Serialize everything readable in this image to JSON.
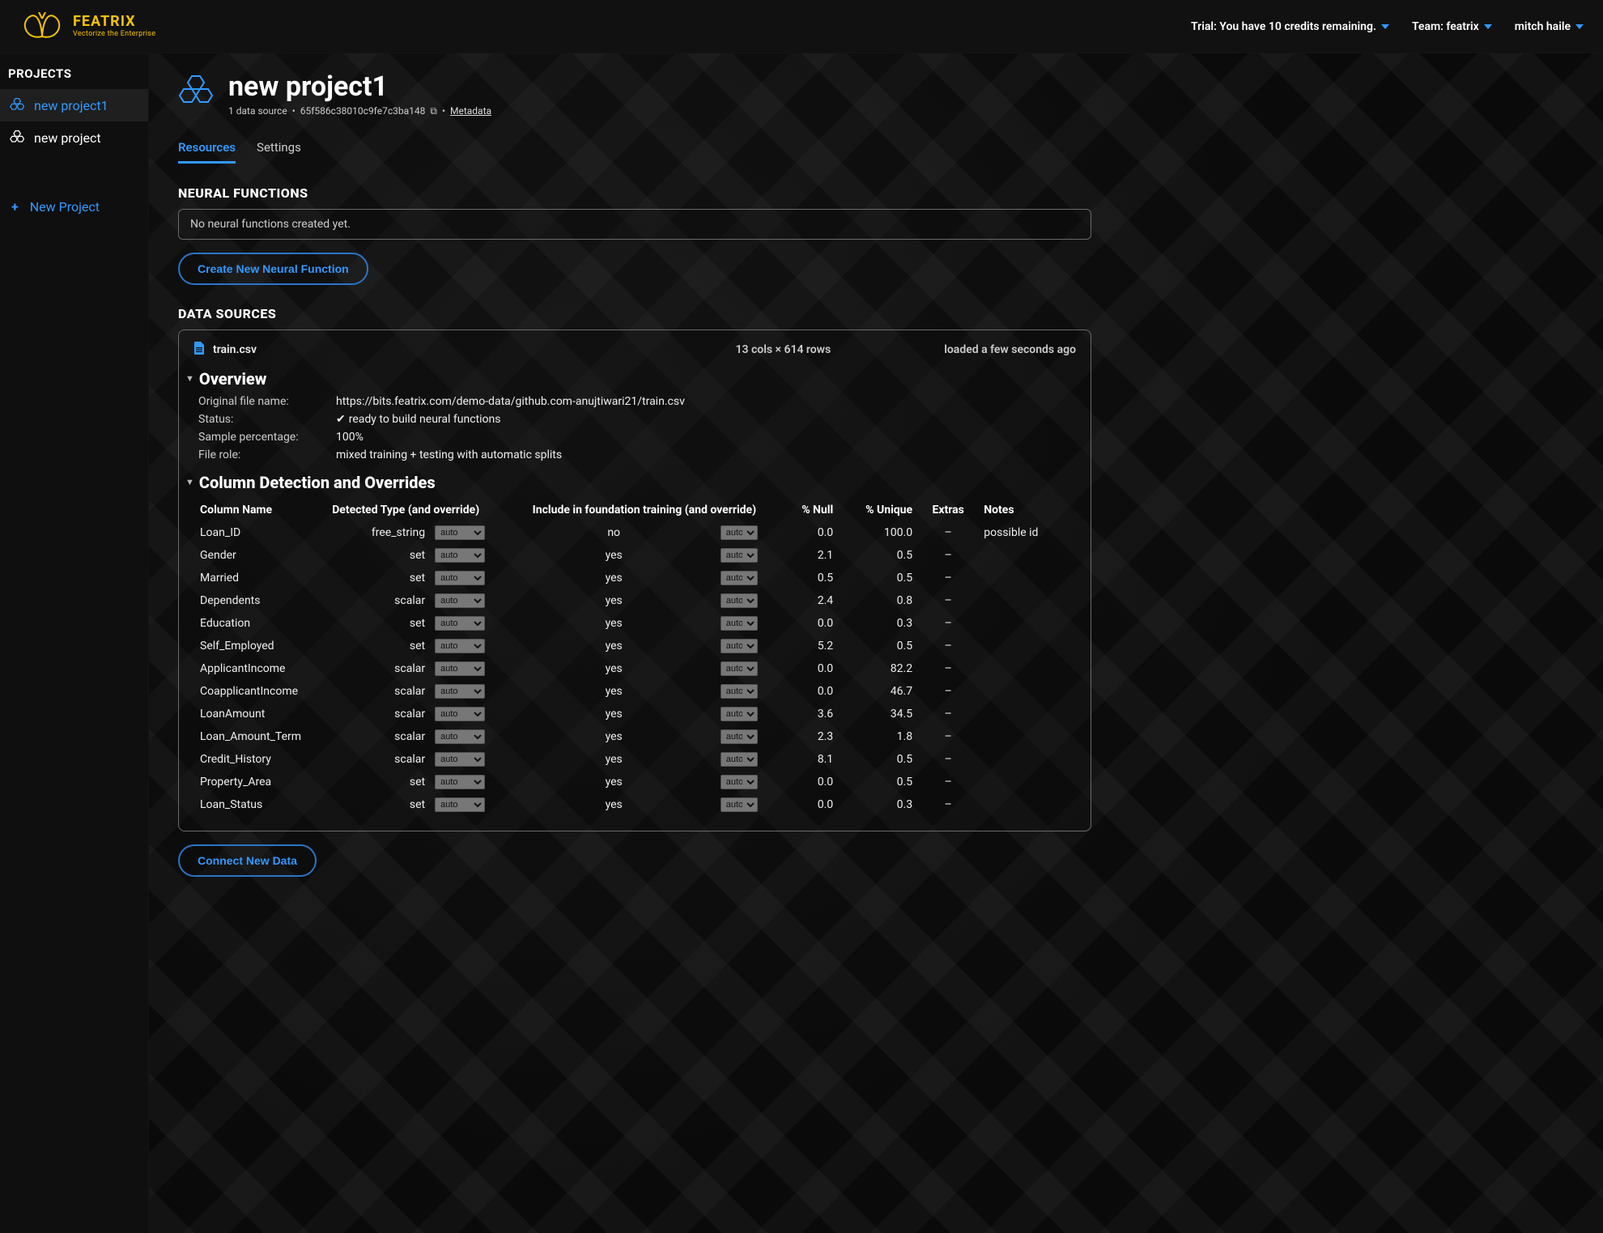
{
  "brand": {
    "name": "FEATRIX",
    "tagline": "Vectorize the Enterprise"
  },
  "topbar": {
    "trial_text": "Trial: You have 10 credits remaining.",
    "team_label": "Team: featrix",
    "user_name": "mitch haile"
  },
  "sidebar": {
    "heading": "PROJECTS",
    "items": [
      {
        "label": "new project1",
        "active": true
      },
      {
        "label": "new project",
        "active": false
      }
    ],
    "new_label": "New Project"
  },
  "project": {
    "title": "new project1",
    "sub_prefix": "1 data source",
    "id": "65f586c38010c9fe7c3ba148",
    "metadata_label": "Metadata"
  },
  "tabs": {
    "resources": "Resources",
    "settings": "Settings"
  },
  "neural": {
    "heading": "NEURAL FUNCTIONS",
    "empty": "No neural functions created yet.",
    "create_btn": "Create New Neural Function"
  },
  "data_sources": {
    "heading": "DATA SOURCES",
    "file_name": "train.csv",
    "dims": "13 cols × 614 rows",
    "loaded": "loaded a few seconds ago",
    "overview": {
      "heading": "Overview",
      "original_label": "Original file name:",
      "original_value": "https://bits.featrix.com/demo-data/github.com-anujtiwari21/train.csv",
      "status_label": "Status:",
      "status_value": "ready to build neural functions",
      "sample_label": "Sample percentage:",
      "sample_value": "100%",
      "role_label": "File role:",
      "role_value": "mixed training + testing with automatic splits"
    },
    "columns": {
      "heading": "Column Detection and Overrides",
      "headers": {
        "name": "Column Name",
        "detected": "Detected Type (and override)",
        "include": "Include in foundation training (and override)",
        "null": "% Null",
        "unique": "% Unique",
        "extras": "Extras",
        "notes": "Notes"
      },
      "auto_label": "auto",
      "rows": [
        {
          "name": "Loan_ID",
          "dtype": "free_string",
          "include": "no",
          "null": "0.0",
          "unique": "100.0",
          "extras": "–",
          "notes": "possible id"
        },
        {
          "name": "Gender",
          "dtype": "set",
          "include": "yes",
          "null": "2.1",
          "unique": "0.5",
          "extras": "–",
          "notes": ""
        },
        {
          "name": "Married",
          "dtype": "set",
          "include": "yes",
          "null": "0.5",
          "unique": "0.5",
          "extras": "–",
          "notes": ""
        },
        {
          "name": "Dependents",
          "dtype": "scalar",
          "include": "yes",
          "null": "2.4",
          "unique": "0.8",
          "extras": "–",
          "notes": ""
        },
        {
          "name": "Education",
          "dtype": "set",
          "include": "yes",
          "null": "0.0",
          "unique": "0.3",
          "extras": "–",
          "notes": ""
        },
        {
          "name": "Self_Employed",
          "dtype": "set",
          "include": "yes",
          "null": "5.2",
          "unique": "0.5",
          "extras": "–",
          "notes": ""
        },
        {
          "name": "ApplicantIncome",
          "dtype": "scalar",
          "include": "yes",
          "null": "0.0",
          "unique": "82.2",
          "extras": "–",
          "notes": ""
        },
        {
          "name": "CoapplicantIncome",
          "dtype": "scalar",
          "include": "yes",
          "null": "0.0",
          "unique": "46.7",
          "extras": "–",
          "notes": ""
        },
        {
          "name": "LoanAmount",
          "dtype": "scalar",
          "include": "yes",
          "null": "3.6",
          "unique": "34.5",
          "extras": "–",
          "notes": ""
        },
        {
          "name": "Loan_Amount_Term",
          "dtype": "scalar",
          "include": "yes",
          "null": "2.3",
          "unique": "1.8",
          "extras": "–",
          "notes": ""
        },
        {
          "name": "Credit_History",
          "dtype": "scalar",
          "include": "yes",
          "null": "8.1",
          "unique": "0.5",
          "extras": "–",
          "notes": ""
        },
        {
          "name": "Property_Area",
          "dtype": "set",
          "include": "yes",
          "null": "0.0",
          "unique": "0.5",
          "extras": "–",
          "notes": ""
        },
        {
          "name": "Loan_Status",
          "dtype": "set",
          "include": "yes",
          "null": "0.0",
          "unique": "0.3",
          "extras": "–",
          "notes": ""
        }
      ]
    },
    "connect_btn": "Connect New Data"
  }
}
